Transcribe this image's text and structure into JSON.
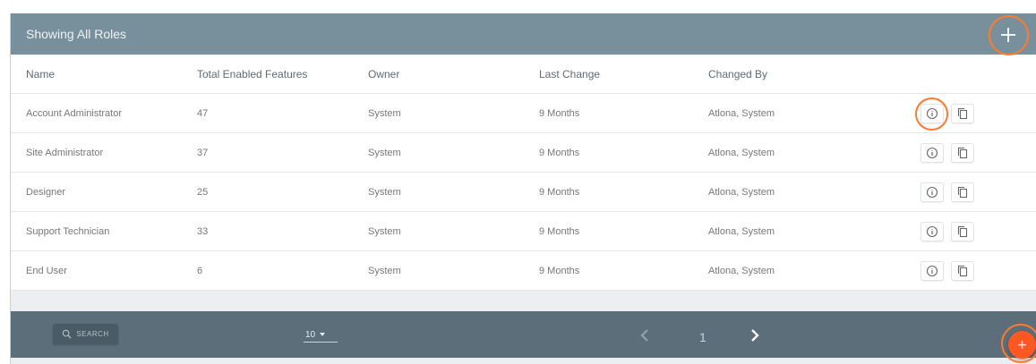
{
  "header": {
    "title": "Showing All Roles",
    "add_icon": "plus-icon"
  },
  "columns": [
    "Name",
    "Total Enabled Features",
    "Owner",
    "Last Change",
    "Changed By"
  ],
  "rows": [
    {
      "name": "Account Administrator",
      "features": "47",
      "owner": "System",
      "last_change": "9 Months",
      "changed_by": "Atlona, System"
    },
    {
      "name": "Site Administrator",
      "features": "37",
      "owner": "System",
      "last_change": "9 Months",
      "changed_by": "Atlona, System"
    },
    {
      "name": "Designer",
      "features": "25",
      "owner": "System",
      "last_change": "9 Months",
      "changed_by": "Atlona, System"
    },
    {
      "name": "Support Technician",
      "features": "33",
      "owner": "System",
      "last_change": "9 Months",
      "changed_by": "Atlona, System"
    },
    {
      "name": "End User",
      "features": "6",
      "owner": "System",
      "last_change": "9 Months",
      "changed_by": "Atlona, System"
    }
  ],
  "footer": {
    "search_label": "SEARCH",
    "page_size": "10",
    "current_page": "1"
  },
  "colors": {
    "header_bg": "#78909c",
    "footer_bg": "#5b6e79",
    "accent": "#ff5722",
    "highlight_ring": "#ff7a2f"
  }
}
